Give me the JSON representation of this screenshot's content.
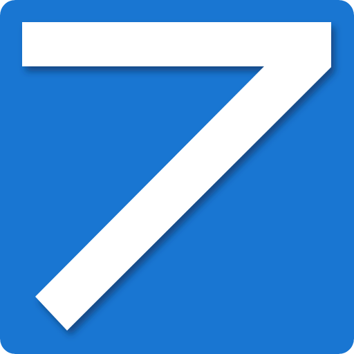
{
  "icon": {
    "glyph": "7",
    "name": "seven-icon",
    "colors": {
      "background": "#1976D2",
      "glyph": "#FFFFFF",
      "shadow": "#0A2E5C"
    }
  }
}
